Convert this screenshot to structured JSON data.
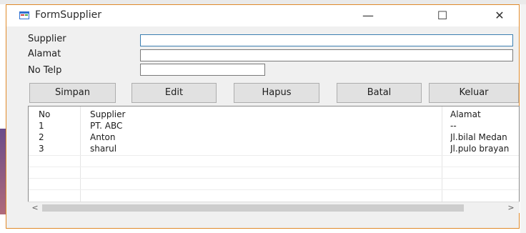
{
  "window": {
    "title": "FormSupplier",
    "controls": {
      "minimize": "—",
      "maximize": "☐",
      "close": "✕"
    }
  },
  "form": {
    "supplier_label": "Supplier",
    "alamat_label": "Alamat",
    "notelp_label": "No Telp",
    "supplier_value": "",
    "alamat_value": "",
    "notelp_value": ""
  },
  "buttons": {
    "simpan": "Simpan",
    "edit": "Edit",
    "hapus": "Hapus",
    "batal": "Batal",
    "keluar": "Keluar"
  },
  "grid": {
    "columns": [
      "No",
      "Supplier",
      "Alamat"
    ],
    "rows": [
      {
        "no": "1",
        "supplier": "PT. ABC",
        "alamat": "--"
      },
      {
        "no": "2",
        "supplier": "Anton",
        "alamat": "Jl.bilal Medan"
      },
      {
        "no": "3",
        "supplier": "sharul",
        "alamat": "Jl.pulo brayan"
      }
    ]
  },
  "scrollbar": {
    "left_arrow": "<",
    "right_arrow": ">"
  },
  "colors": {
    "window_border": "#e08a2a",
    "focus_border": "#3c7fb1",
    "button_face": "#e1e1e1"
  },
  "icons": [
    "form-app-icon",
    "minimize-icon",
    "maximize-icon",
    "close-icon",
    "scroll-left-icon",
    "scroll-right-icon"
  ]
}
